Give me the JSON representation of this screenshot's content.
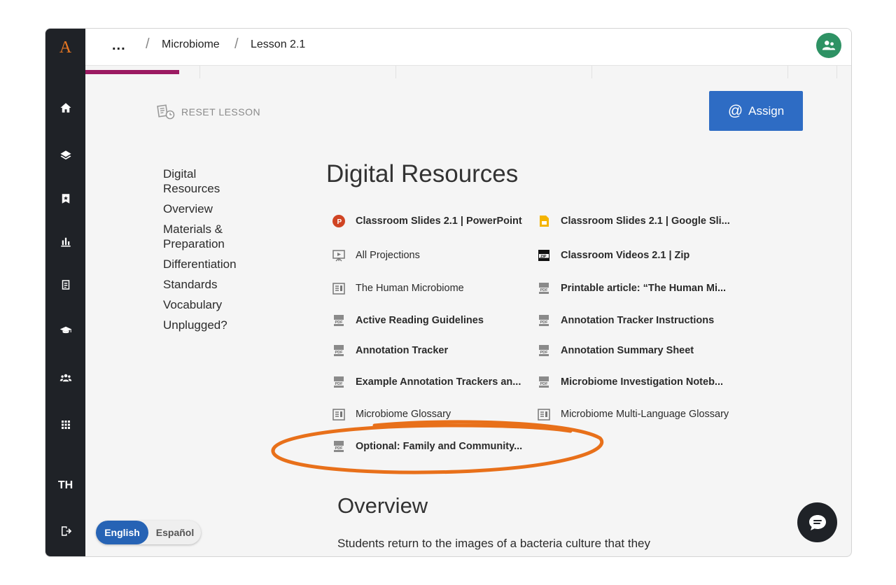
{
  "app": {
    "logo_letter": "A",
    "user_initials": "TH"
  },
  "breadcrumb": {
    "more": "...",
    "items": [
      "Microbiome",
      "Lesson 2.1"
    ]
  },
  "sidebar": {
    "icons": [
      "home-icon",
      "layers-icon",
      "bookmark-icon",
      "bar-chart-icon",
      "document-icon",
      "graduation-cap-icon",
      "people-icon",
      "apps-grid-icon",
      "logout-icon"
    ]
  },
  "toolbar": {
    "reset_label": "RESET LESSON",
    "assign_label": "Assign"
  },
  "toc": {
    "items": [
      "Digital Resources",
      "Overview",
      "Materials & Preparation",
      "Differentiation",
      "Standards",
      "Vocabulary",
      "Unplugged?"
    ]
  },
  "digital_resources": {
    "title": "Digital Resources",
    "items": [
      {
        "label": "Classroom Slides 2.1 | PowerPoint",
        "icon": "powerpoint-icon"
      },
      {
        "label": "Classroom Slides 2.1 | Google Sli...",
        "icon": "google-slides-icon"
      },
      {
        "label": "All Projections",
        "icon": "projection-icon"
      },
      {
        "label": "Classroom Videos 2.1 | Zip",
        "icon": "zip-icon"
      },
      {
        "label": "The Human Microbiome",
        "icon": "article-icon"
      },
      {
        "label": "Printable article: “The Human Mi...",
        "icon": "pdf-icon"
      },
      {
        "label": "Active Reading Guidelines",
        "icon": "pdf-icon"
      },
      {
        "label": "Annotation Tracker Instructions",
        "icon": "pdf-icon"
      },
      {
        "label": "Annotation Tracker",
        "icon": "pdf-icon"
      },
      {
        "label": "Annotation Summary Sheet",
        "icon": "pdf-icon"
      },
      {
        "label": "Example Annotation Trackers an...",
        "icon": "pdf-icon"
      },
      {
        "label": "Microbiome Investigation Noteb...",
        "icon": "pdf-icon"
      },
      {
        "label": "Microbiome Glossary",
        "icon": "article-icon"
      },
      {
        "label": "Microbiome Multi-Language Glossary",
        "icon": "article-icon"
      },
      {
        "label": "Optional: Family and Community...",
        "icon": "pdf-icon"
      }
    ]
  },
  "overview": {
    "title": "Overview",
    "text": "Students return to the images of a bacteria culture that they"
  },
  "language": {
    "english": "English",
    "spanish": "Español",
    "selected": "English"
  },
  "colors": {
    "accent_blue": "#2e6cc4",
    "sidebar_bg": "#1f2227",
    "progress": "#9b1a62",
    "logo": "#e87722",
    "annotation": "#e8701a"
  }
}
